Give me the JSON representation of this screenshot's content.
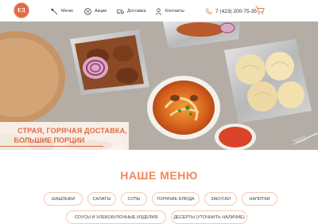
{
  "header": {
    "logo_text": "ЕД",
    "nav": [
      {
        "label": "Меню",
        "icon": "knife-fork-icon"
      },
      {
        "label": "Акции",
        "icon": "percent-icon"
      },
      {
        "label": "Доставка",
        "icon": "truck-icon"
      },
      {
        "label": "Контакты",
        "icon": "person-icon"
      }
    ],
    "phone": "7 (423) 200-75-35"
  },
  "hero": {
    "line1": "СТРАЯ, ГОРЯЧАЯ ДОСТАВКА,",
    "line2": "БОЛЬШИЕ ПОРЦИИ"
  },
  "menu": {
    "title": "НАШЕ МЕНЮ",
    "categories": [
      "ШАШЛЫКИ",
      "САЛАТЫ",
      "СУПЫ",
      "ГОРЯЧИЕ БЛЮДА",
      "ЗАКУСКИ",
      "НАПИТКИ",
      "СОУСЫ И ХЛЕБОБУЛОЧНЫЕ ИЗДЕЛИЯ",
      "ДЕСЕРТЫ (УТОЧНИТЬ НАЛИЧИЕ)"
    ]
  },
  "colors": {
    "accent": "#df6b47",
    "title": "#ef8a5c",
    "pill_border": "#f2c9b7"
  }
}
